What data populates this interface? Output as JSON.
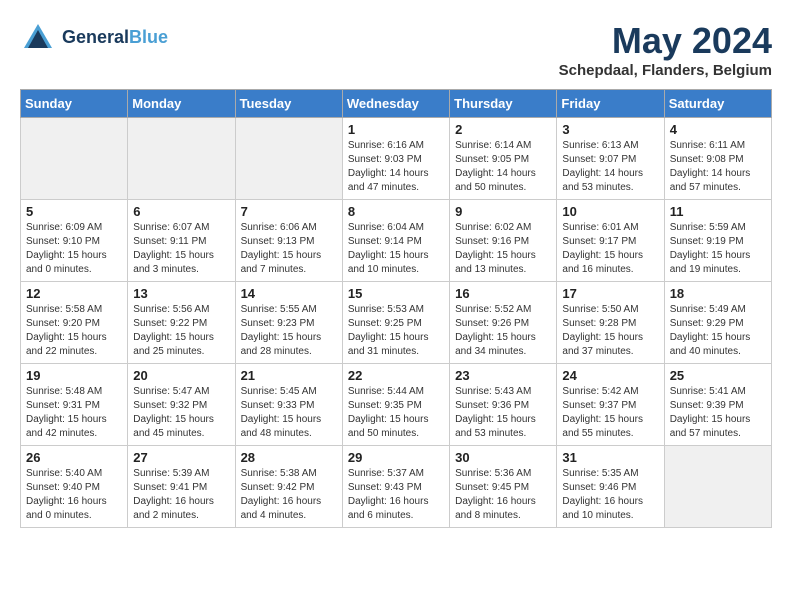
{
  "header": {
    "logo_line1": "General",
    "logo_line2": "Blue",
    "month": "May 2024",
    "location": "Schepdaal, Flanders, Belgium"
  },
  "weekdays": [
    "Sunday",
    "Monday",
    "Tuesday",
    "Wednesday",
    "Thursday",
    "Friday",
    "Saturday"
  ],
  "weeks": [
    [
      {
        "day": "",
        "info": "",
        "shaded": true
      },
      {
        "day": "",
        "info": "",
        "shaded": true
      },
      {
        "day": "",
        "info": "",
        "shaded": true
      },
      {
        "day": "1",
        "info": "Sunrise: 6:16 AM\nSunset: 9:03 PM\nDaylight: 14 hours\nand 47 minutes."
      },
      {
        "day": "2",
        "info": "Sunrise: 6:14 AM\nSunset: 9:05 PM\nDaylight: 14 hours\nand 50 minutes."
      },
      {
        "day": "3",
        "info": "Sunrise: 6:13 AM\nSunset: 9:07 PM\nDaylight: 14 hours\nand 53 minutes."
      },
      {
        "day": "4",
        "info": "Sunrise: 6:11 AM\nSunset: 9:08 PM\nDaylight: 14 hours\nand 57 minutes."
      }
    ],
    [
      {
        "day": "5",
        "info": "Sunrise: 6:09 AM\nSunset: 9:10 PM\nDaylight: 15 hours\nand 0 minutes."
      },
      {
        "day": "6",
        "info": "Sunrise: 6:07 AM\nSunset: 9:11 PM\nDaylight: 15 hours\nand 3 minutes."
      },
      {
        "day": "7",
        "info": "Sunrise: 6:06 AM\nSunset: 9:13 PM\nDaylight: 15 hours\nand 7 minutes."
      },
      {
        "day": "8",
        "info": "Sunrise: 6:04 AM\nSunset: 9:14 PM\nDaylight: 15 hours\nand 10 minutes."
      },
      {
        "day": "9",
        "info": "Sunrise: 6:02 AM\nSunset: 9:16 PM\nDaylight: 15 hours\nand 13 minutes."
      },
      {
        "day": "10",
        "info": "Sunrise: 6:01 AM\nSunset: 9:17 PM\nDaylight: 15 hours\nand 16 minutes."
      },
      {
        "day": "11",
        "info": "Sunrise: 5:59 AM\nSunset: 9:19 PM\nDaylight: 15 hours\nand 19 minutes."
      }
    ],
    [
      {
        "day": "12",
        "info": "Sunrise: 5:58 AM\nSunset: 9:20 PM\nDaylight: 15 hours\nand 22 minutes."
      },
      {
        "day": "13",
        "info": "Sunrise: 5:56 AM\nSunset: 9:22 PM\nDaylight: 15 hours\nand 25 minutes."
      },
      {
        "day": "14",
        "info": "Sunrise: 5:55 AM\nSunset: 9:23 PM\nDaylight: 15 hours\nand 28 minutes."
      },
      {
        "day": "15",
        "info": "Sunrise: 5:53 AM\nSunset: 9:25 PM\nDaylight: 15 hours\nand 31 minutes."
      },
      {
        "day": "16",
        "info": "Sunrise: 5:52 AM\nSunset: 9:26 PM\nDaylight: 15 hours\nand 34 minutes."
      },
      {
        "day": "17",
        "info": "Sunrise: 5:50 AM\nSunset: 9:28 PM\nDaylight: 15 hours\nand 37 minutes."
      },
      {
        "day": "18",
        "info": "Sunrise: 5:49 AM\nSunset: 9:29 PM\nDaylight: 15 hours\nand 40 minutes."
      }
    ],
    [
      {
        "day": "19",
        "info": "Sunrise: 5:48 AM\nSunset: 9:31 PM\nDaylight: 15 hours\nand 42 minutes."
      },
      {
        "day": "20",
        "info": "Sunrise: 5:47 AM\nSunset: 9:32 PM\nDaylight: 15 hours\nand 45 minutes."
      },
      {
        "day": "21",
        "info": "Sunrise: 5:45 AM\nSunset: 9:33 PM\nDaylight: 15 hours\nand 48 minutes."
      },
      {
        "day": "22",
        "info": "Sunrise: 5:44 AM\nSunset: 9:35 PM\nDaylight: 15 hours\nand 50 minutes."
      },
      {
        "day": "23",
        "info": "Sunrise: 5:43 AM\nSunset: 9:36 PM\nDaylight: 15 hours\nand 53 minutes."
      },
      {
        "day": "24",
        "info": "Sunrise: 5:42 AM\nSunset: 9:37 PM\nDaylight: 15 hours\nand 55 minutes."
      },
      {
        "day": "25",
        "info": "Sunrise: 5:41 AM\nSunset: 9:39 PM\nDaylight: 15 hours\nand 57 minutes."
      }
    ],
    [
      {
        "day": "26",
        "info": "Sunrise: 5:40 AM\nSunset: 9:40 PM\nDaylight: 16 hours\nand 0 minutes."
      },
      {
        "day": "27",
        "info": "Sunrise: 5:39 AM\nSunset: 9:41 PM\nDaylight: 16 hours\nand 2 minutes."
      },
      {
        "day": "28",
        "info": "Sunrise: 5:38 AM\nSunset: 9:42 PM\nDaylight: 16 hours\nand 4 minutes."
      },
      {
        "day": "29",
        "info": "Sunrise: 5:37 AM\nSunset: 9:43 PM\nDaylight: 16 hours\nand 6 minutes."
      },
      {
        "day": "30",
        "info": "Sunrise: 5:36 AM\nSunset: 9:45 PM\nDaylight: 16 hours\nand 8 minutes."
      },
      {
        "day": "31",
        "info": "Sunrise: 5:35 AM\nSunset: 9:46 PM\nDaylight: 16 hours\nand 10 minutes."
      },
      {
        "day": "",
        "info": "",
        "shaded": true
      }
    ]
  ]
}
